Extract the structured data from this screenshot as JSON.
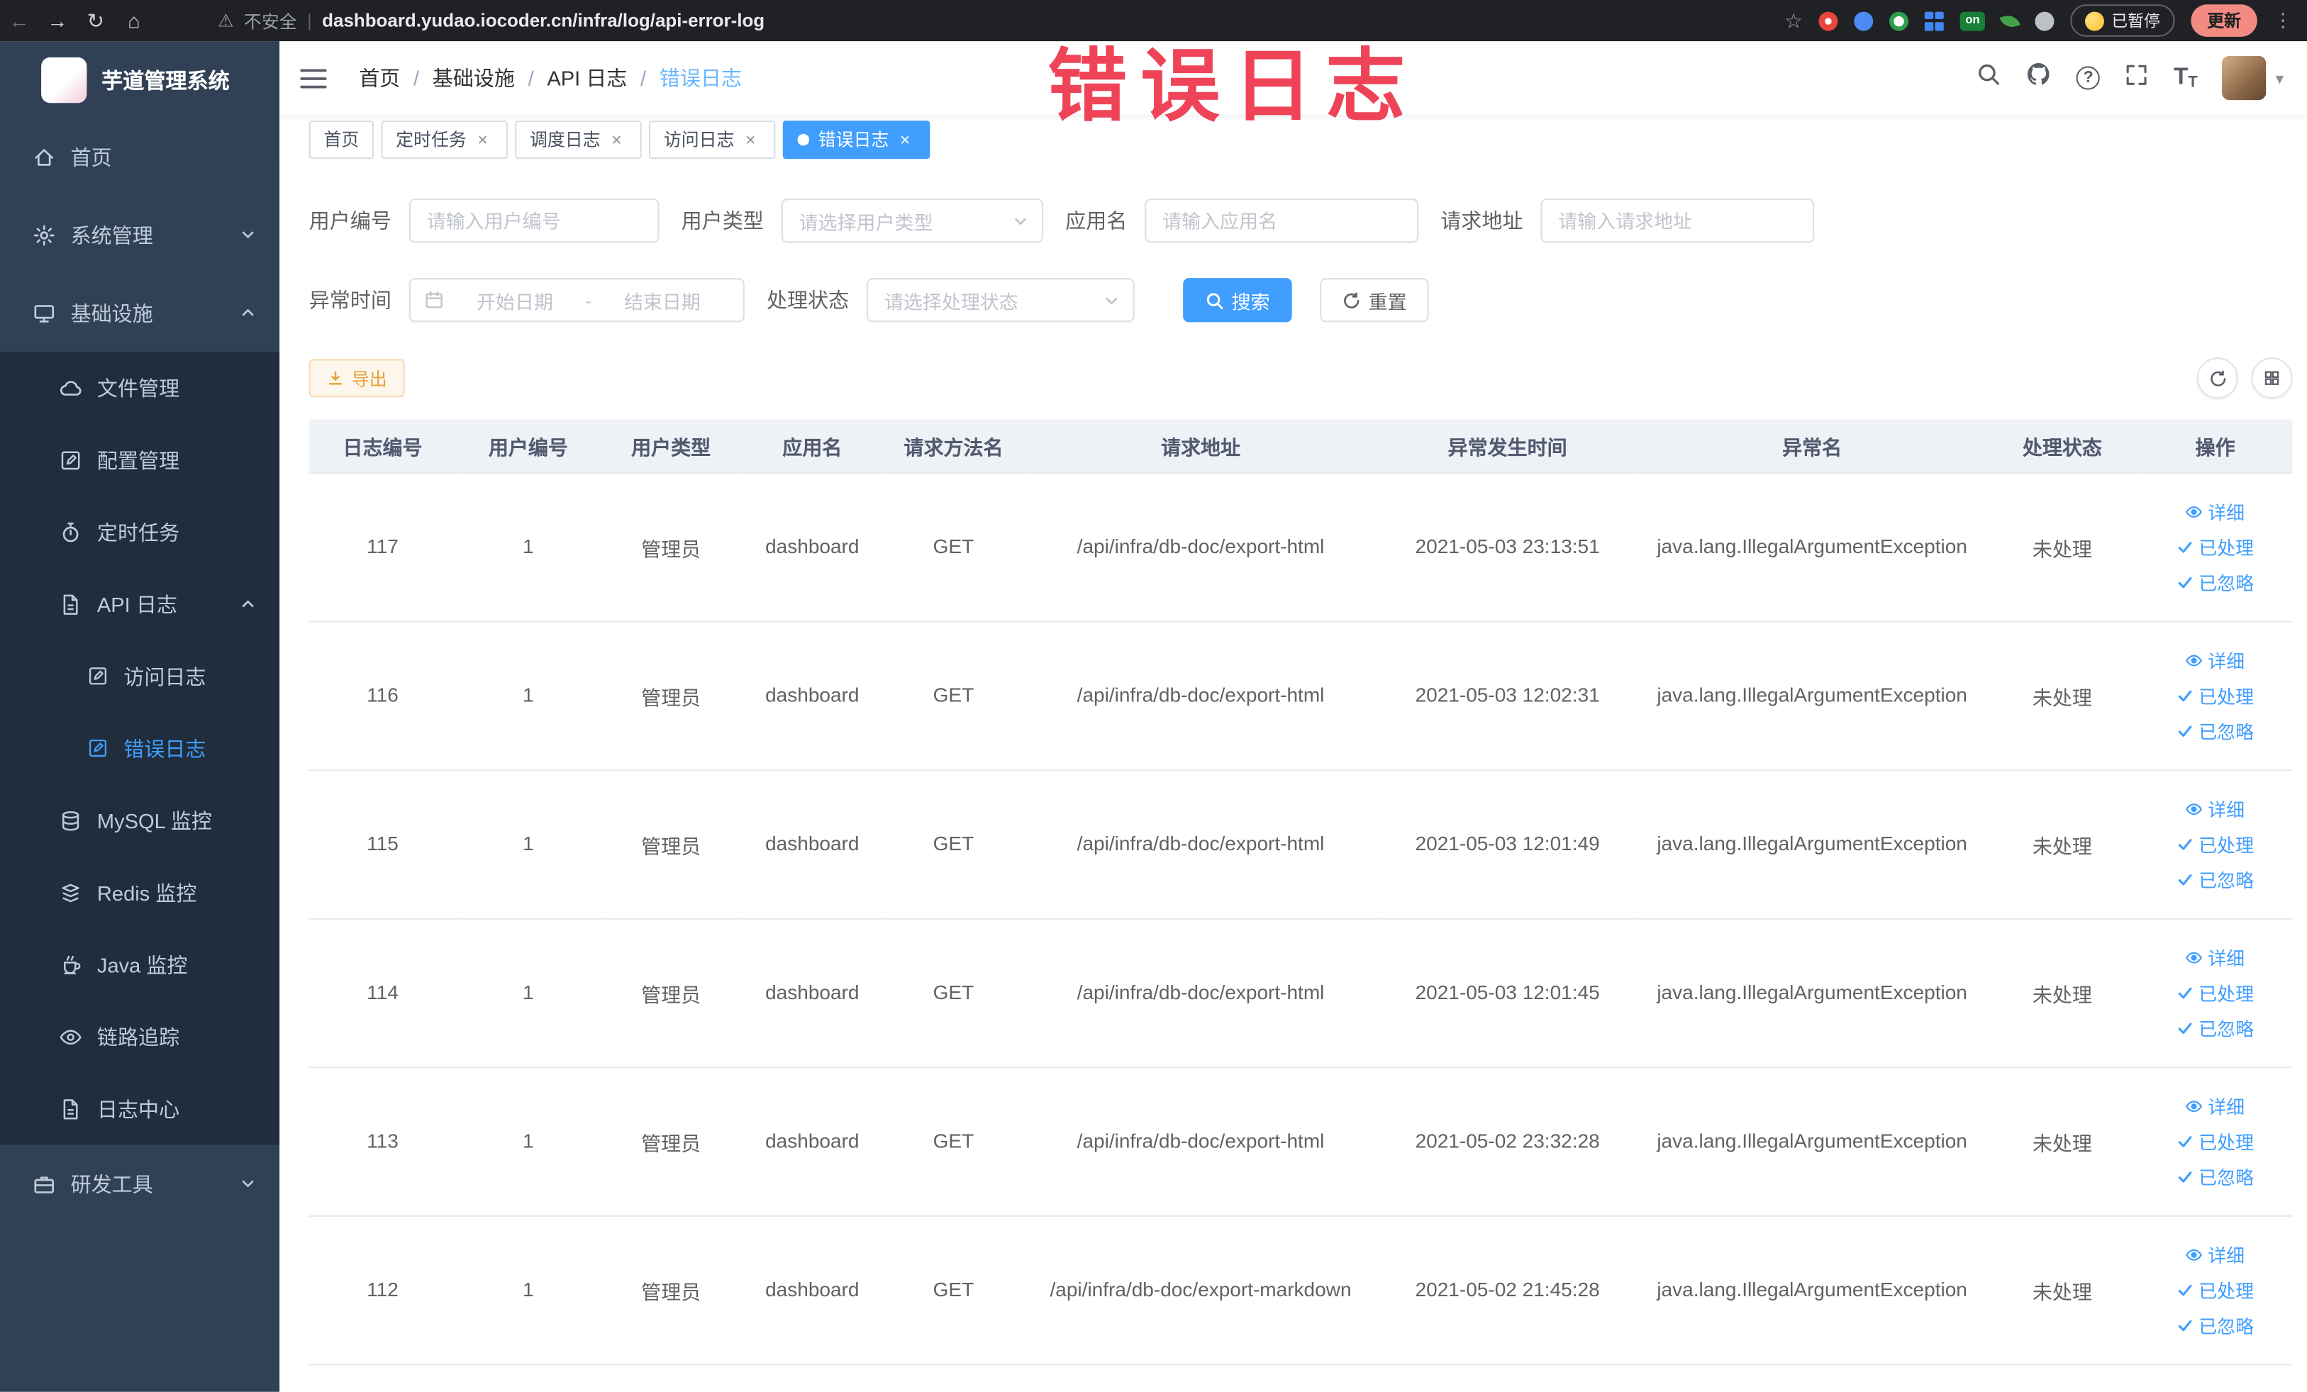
{
  "icons": {
    "back": "←",
    "forward": "→",
    "reload": "↻",
    "home": "⌂",
    "warning": "⚠",
    "star": "☆",
    "kebab": "⋮",
    "caret": "▾",
    "close": "×",
    "crumb_sep": "/",
    "question": "?",
    "on": "on",
    "font_big": "T",
    "font_small": "T"
  },
  "browser": {
    "security_label": "不安全",
    "url": "dashboard.yudao.iocoder.cn/infra/log/api-error-log",
    "paused_badge": "已暂停",
    "update_label": "更新"
  },
  "watermark": "错误日志",
  "sidebar": {
    "logo_title": "芋道管理系统",
    "items": [
      {
        "label": "首页"
      },
      {
        "label": "系统管理"
      },
      {
        "label": "基础设施"
      },
      {
        "label": "文件管理"
      },
      {
        "label": "配置管理"
      },
      {
        "label": "定时任务"
      },
      {
        "label": "API 日志"
      },
      {
        "label": "访问日志"
      },
      {
        "label": "错误日志"
      },
      {
        "label": "MySQL 监控"
      },
      {
        "label": "Redis 监控"
      },
      {
        "label": "Java 监控"
      },
      {
        "label": "链路追踪"
      },
      {
        "label": "日志中心"
      },
      {
        "label": "研发工具"
      }
    ]
  },
  "breadcrumb": {
    "items": [
      "首页",
      "基础设施",
      "API 日志",
      "错误日志"
    ]
  },
  "tabs": [
    {
      "label": "首页"
    },
    {
      "label": "定时任务"
    },
    {
      "label": "调度日志"
    },
    {
      "label": "访问日志"
    },
    {
      "label": "错误日志"
    }
  ],
  "filters": {
    "user_id": {
      "label": "用户编号",
      "placeholder": "请输入用户编号"
    },
    "user_type": {
      "label": "用户类型",
      "placeholder": "请选择用户类型"
    },
    "app_name": {
      "label": "应用名",
      "placeholder": "请输入应用名"
    },
    "request_url": {
      "label": "请求地址",
      "placeholder": "请输入请求地址"
    },
    "exception_time": {
      "label": "异常时间",
      "start_placeholder": "开始日期",
      "separator": "-",
      "end_placeholder": "结束日期"
    },
    "process_status": {
      "label": "处理状态",
      "placeholder": "请选择处理状态"
    },
    "search_button": "搜索",
    "reset_button": "重置"
  },
  "toolbar": {
    "export_button": "导出"
  },
  "table": {
    "columns": [
      "日志编号",
      "用户编号",
      "用户类型",
      "应用名",
      "请求方法名",
      "请求地址",
      "异常发生时间",
      "异常名",
      "处理状态",
      "操作"
    ],
    "row_actions": [
      "详细",
      "已处理",
      "已忽略"
    ],
    "rows": [
      {
        "id": "117",
        "user_id": "1",
        "user_type": "管理员",
        "app": "dashboard",
        "method": "GET",
        "url": "/api/infra/db-doc/export-html",
        "time": "2021-05-03 23:13:51",
        "exception": "java.lang.IllegalArgumentException",
        "status": "未处理"
      },
      {
        "id": "116",
        "user_id": "1",
        "user_type": "管理员",
        "app": "dashboard",
        "method": "GET",
        "url": "/api/infra/db-doc/export-html",
        "time": "2021-05-03 12:02:31",
        "exception": "java.lang.IllegalArgumentException",
        "status": "未处理"
      },
      {
        "id": "115",
        "user_id": "1",
        "user_type": "管理员",
        "app": "dashboard",
        "method": "GET",
        "url": "/api/infra/db-doc/export-html",
        "time": "2021-05-03 12:01:49",
        "exception": "java.lang.IllegalArgumentException",
        "status": "未处理"
      },
      {
        "id": "114",
        "user_id": "1",
        "user_type": "管理员",
        "app": "dashboard",
        "method": "GET",
        "url": "/api/infra/db-doc/export-html",
        "time": "2021-05-03 12:01:45",
        "exception": "java.lang.IllegalArgumentException",
        "status": "未处理"
      },
      {
        "id": "113",
        "user_id": "1",
        "user_type": "管理员",
        "app": "dashboard",
        "method": "GET",
        "url": "/api/infra/db-doc/export-html",
        "time": "2021-05-02 23:32:28",
        "exception": "java.lang.IllegalArgumentException",
        "status": "未处理"
      },
      {
        "id": "112",
        "user_id": "1",
        "user_type": "管理员",
        "app": "dashboard",
        "method": "GET",
        "url": "/api/infra/db-doc/export-markdown",
        "time": "2021-05-02 21:45:28",
        "exception": "java.lang.IllegalArgumentException",
        "status": "未处理"
      }
    ]
  },
  "colors": {
    "accent": "#409EFF",
    "warning": "#e6a23c",
    "watermark": "#ef4458",
    "sidebar_bg": "#304156",
    "submenu_bg": "#1f2d3d"
  }
}
